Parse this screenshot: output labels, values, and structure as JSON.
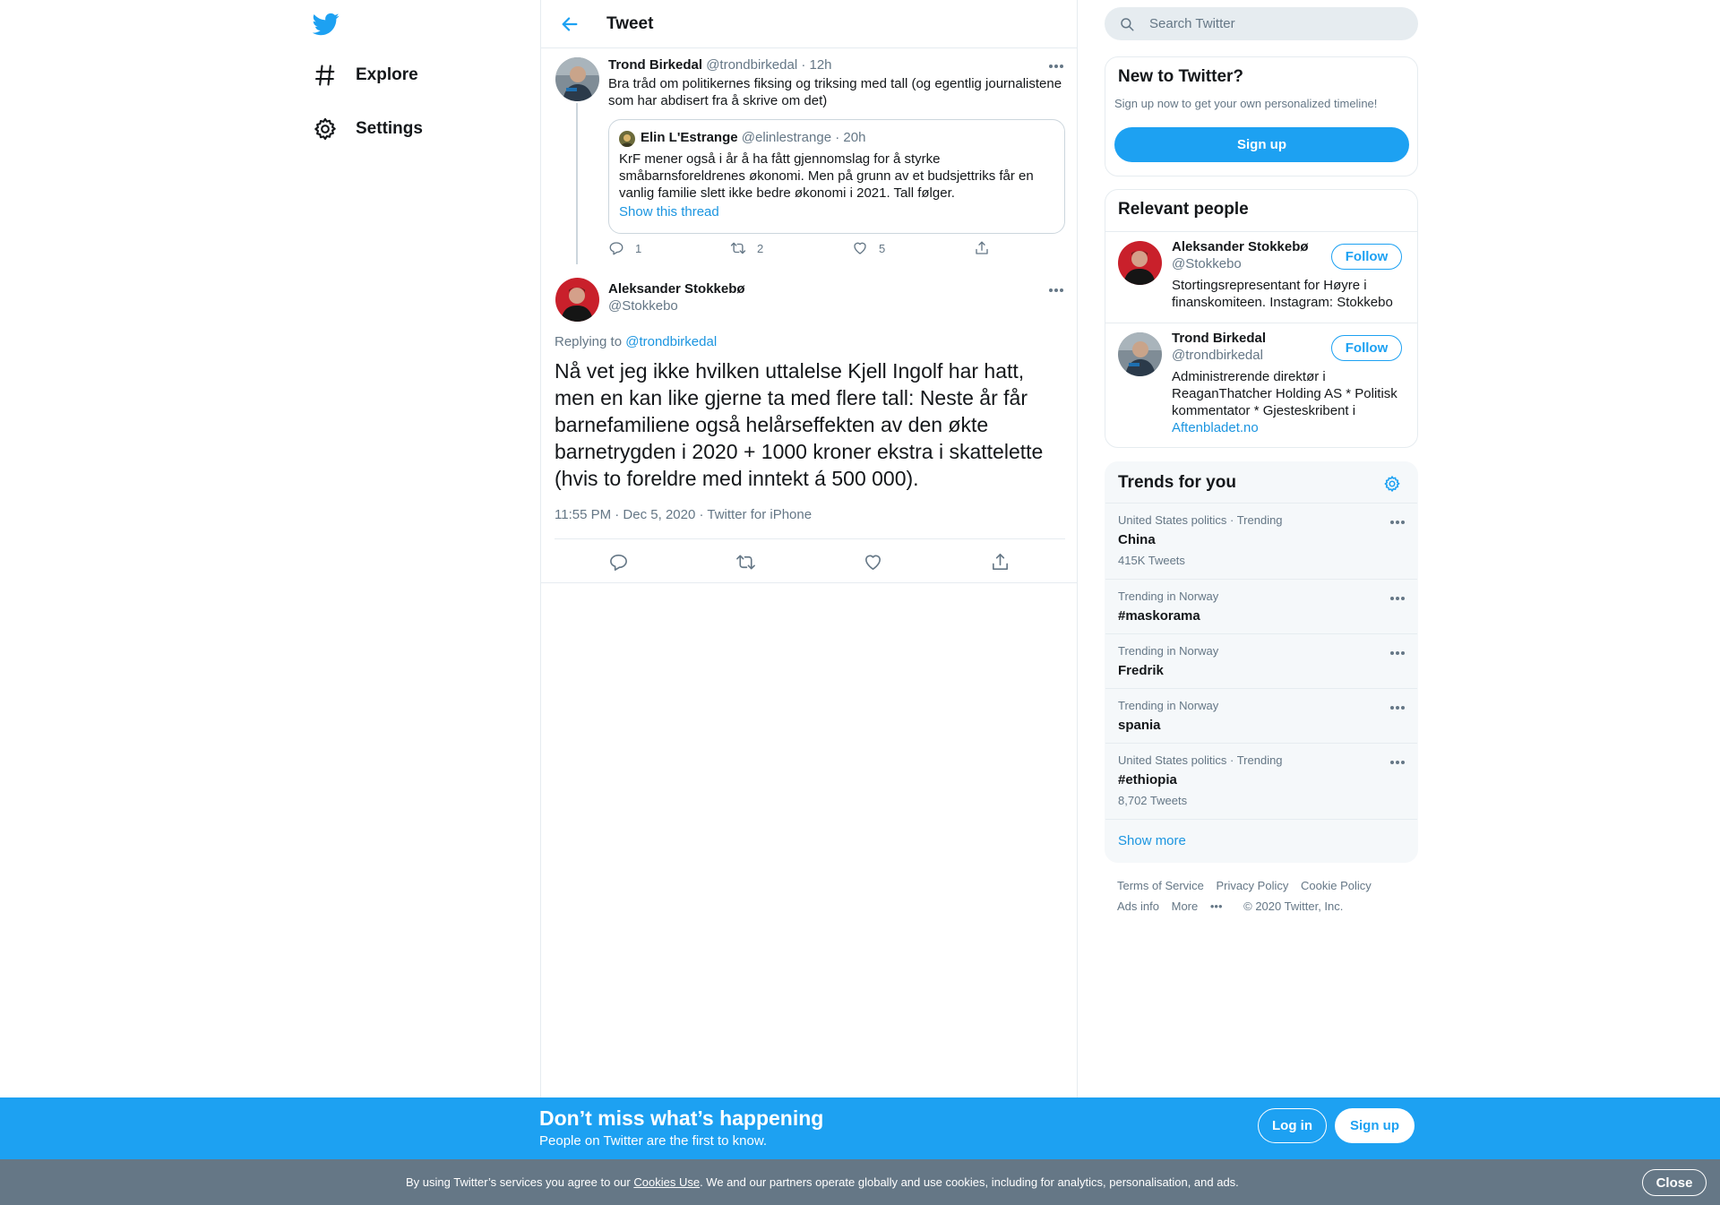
{
  "nav": {
    "items": [
      {
        "label": "Explore",
        "icon": "hashtag-icon"
      },
      {
        "label": "Settings",
        "icon": "gear-icon"
      }
    ]
  },
  "header": {
    "title": "Tweet"
  },
  "parent_tweet": {
    "name": "Trond Birkedal",
    "handle": "@trondbirkedal",
    "time": "· 12h",
    "text": "Bra tråd om politikernes fiksing og triksing med tall (og egentlig journalistene som har abdisert fra å skrive om det)",
    "quote": {
      "name": "Elin L'Estrange",
      "handle": "@elinlestrange",
      "time": "· 20h",
      "text": "KrF mener også i år å ha fått gjennomslag for å styrke småbarnsforeldrenes økonomi. Men på grunn av et budsjettriks får en vanlig familie slett ikke bedre økonomi i 2021. Tall følger.",
      "link": "Show this thread"
    },
    "replies": "1",
    "retweets": "2",
    "likes": "5"
  },
  "main_tweet": {
    "name": "Aleksander Stokkebø",
    "handle": "@Stokkebo",
    "replying_prefix": "Replying to",
    "replying_to": "@trondbirkedal",
    "text": "Nå vet jeg ikke hvilken uttalelse Kjell Ingolf har hatt, men en kan like gjerne ta med flere tall: Neste år får barnefamiliene også helårseffekten av den økte barnetrygden i 2020 + 1000 kroner ekstra i skattelette (hvis to foreldre med inntekt á 500 000).",
    "meta": "11:55 PM · Dec 5, 2020 · Twitter for iPhone"
  },
  "search": {
    "placeholder": "Search Twitter"
  },
  "new_to_twitter": {
    "title": "New to Twitter?",
    "subtitle": "Sign up now to get your own personalized timeline!",
    "signup": "Sign up"
  },
  "relevant_people": {
    "title": "Relevant people",
    "people": [
      {
        "name": "Aleksander Stokkebø",
        "handle": "@Stokkebo",
        "bio": "Stortingsrepresentant for Høyre i finanskomiteen. Instagram: Stokkebo",
        "bio_link": "",
        "follow": "Follow"
      },
      {
        "name": "Trond Birkedal",
        "handle": "@trondbirkedal",
        "bio": "Administrerende direktør i ReaganThatcher Holding AS * Politisk kommentator * Gjesteskribent i",
        "bio_link": "Aftenbladet.no",
        "follow": "Follow"
      }
    ]
  },
  "trends": {
    "title": "Trends for you",
    "items": [
      {
        "context": "United States politics · Trending",
        "name": "China",
        "count": "415K Tweets"
      },
      {
        "context": "Trending in Norway",
        "name": "#maskorama",
        "count": ""
      },
      {
        "context": "Trending in Norway",
        "name": "Fredrik",
        "count": ""
      },
      {
        "context": "Trending in Norway",
        "name": "spania",
        "count": ""
      },
      {
        "context": "United States politics · Trending",
        "name": "#ethiopia",
        "count": "8,702 Tweets"
      }
    ],
    "show_more": "Show more"
  },
  "footer": {
    "terms": "Terms of Service",
    "privacy": "Privacy Policy",
    "cookie": "Cookie Policy",
    "ads": "Ads info",
    "more": "More",
    "copyright": "© 2020 Twitter, Inc."
  },
  "banner": {
    "title": "Don’t miss what’s happening",
    "subtitle": "People on Twitter are the first to know.",
    "login": "Log in",
    "signup": "Sign up"
  },
  "cookie_bar": {
    "prefix": "By using Twitter’s services you agree to our",
    "link": "Cookies Use",
    "suffix": ". We and our partners operate globally and use cookies, including for analytics, personalisation, and ads.",
    "close": "Close"
  },
  "colors": {
    "accent": "#1da1f2",
    "link": "#1b95e0",
    "muted": "#657786",
    "border": "#e6ecf0"
  }
}
